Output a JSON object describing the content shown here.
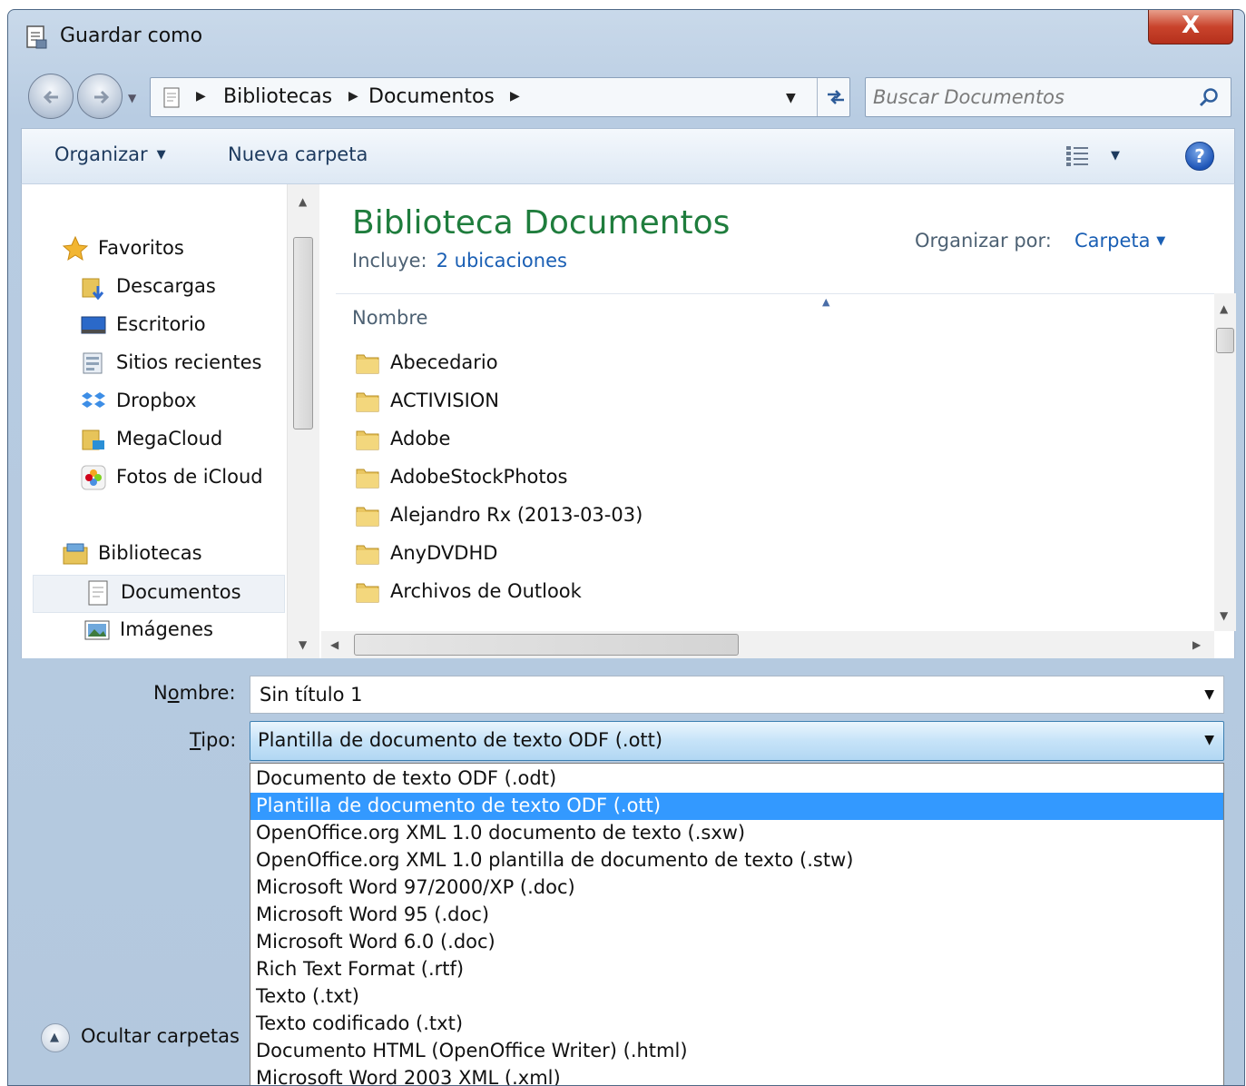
{
  "window": {
    "title": "Guardar como",
    "close_label": "X"
  },
  "address_bar": {
    "crumbs": [
      "Bibliotecas",
      "Documentos"
    ],
    "search_placeholder": "Buscar Documentos"
  },
  "toolbar": {
    "organize_label": "Organizar",
    "new_folder_label": "Nueva carpeta",
    "help_label": "?"
  },
  "navigation": {
    "favorites_header": "Favoritos",
    "favorites": [
      "Descargas",
      "Escritorio",
      "Sitios recientes",
      "Dropbox",
      "MegaCloud",
      "Fotos de iCloud"
    ],
    "libraries_header": "Bibliotecas",
    "libraries": [
      "Documentos",
      "Imágenes"
    ],
    "selected": "Documentos"
  },
  "library": {
    "title": "Biblioteca Documentos",
    "includes_label": "Incluye:",
    "includes_link": "2 ubicaciones",
    "arrange_label": "Organizar por:",
    "arrange_value": "Carpeta"
  },
  "file_list": {
    "column_name": "Nombre",
    "items": [
      "Abecedario",
      "ACTIVISION",
      "Adobe",
      "AdobeStockPhotos",
      "Alejandro Rx (2013-03-03)",
      "AnyDVDHD",
      "Archivos de Outlook"
    ]
  },
  "form": {
    "name_label_pre": "N",
    "name_label_ul": "o",
    "name_label_post": "mbre:",
    "name_value": "Sin título 1",
    "type_label_ul": "T",
    "type_label_post": "ipo:",
    "type_value": "Plantilla de documento de texto ODF (.ott)"
  },
  "type_options": [
    "Documento de texto ODF (.odt)",
    "Plantilla de documento de texto ODF (.ott)",
    "OpenOffice.org XML 1.0 documento de texto (.sxw)",
    "OpenOffice.org XML 1.0 plantilla de documento de texto (.stw)",
    "Microsoft Word 97/2000/XP (.doc)",
    "Microsoft Word 95 (.doc)",
    "Microsoft Word 6.0 (.doc)",
    "Rich Text Format (.rtf)",
    "Texto (.txt)",
    "Texto codificado (.txt)",
    "Documento HTML (OpenOffice Writer) (.html)",
    "Microsoft Word 2003 XML (.xml)"
  ],
  "selected_type_index": 1,
  "footer": {
    "hide_folders_label": "Ocultar carpetas"
  }
}
